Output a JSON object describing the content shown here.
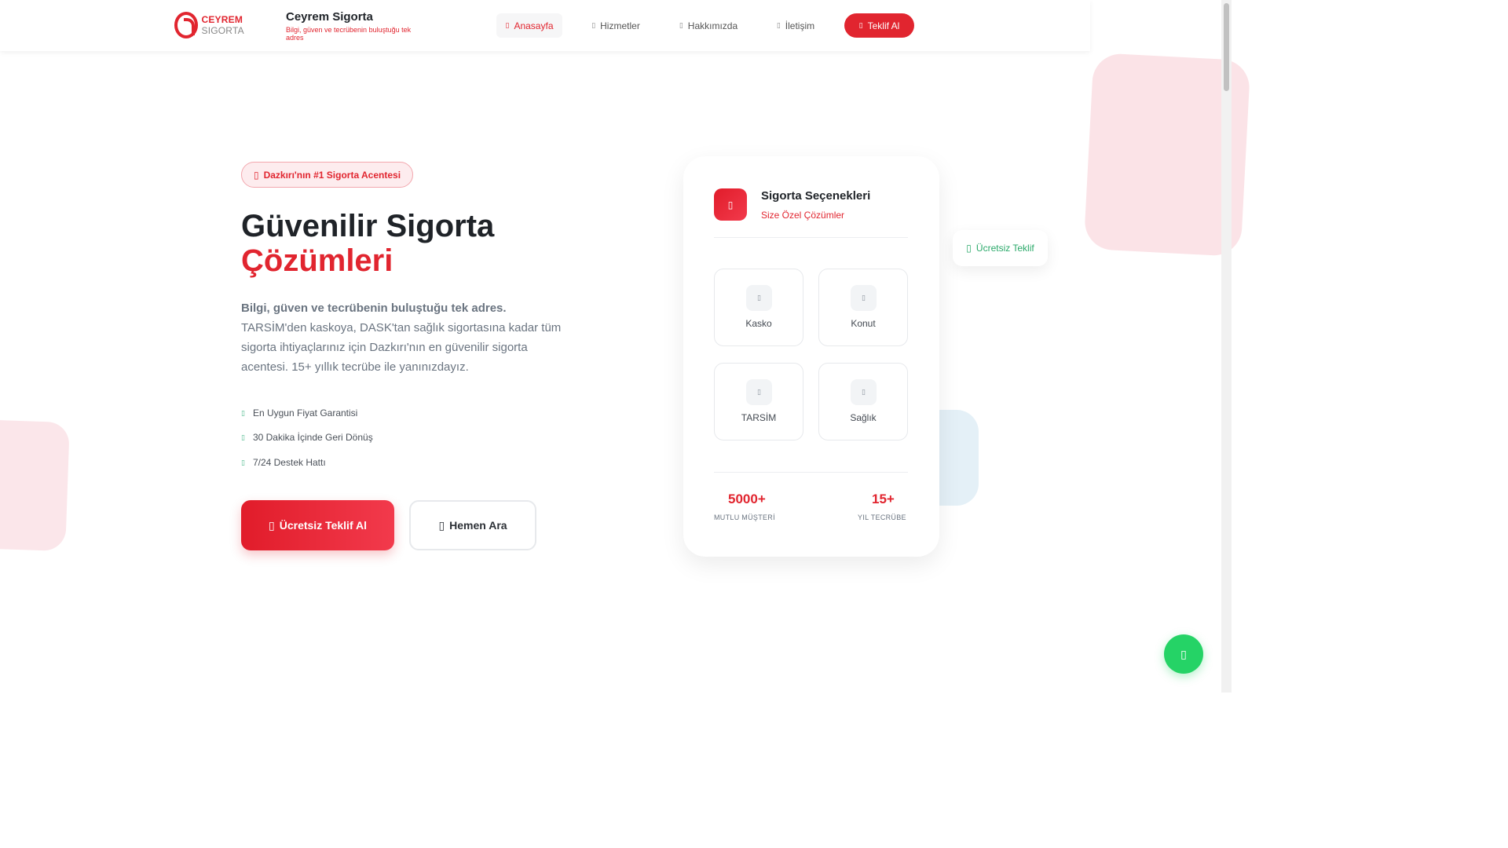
{
  "header": {
    "logo_text_a": "CEYREM",
    "logo_text_b": "SIGORTA",
    "brand_name": "Ceyrem Sigorta",
    "brand_tagline": "Bilgi, güven ve tecrübenin buluştuğu tek adres",
    "nav": {
      "home": "Anasayfa",
      "services": "Hizmetler",
      "about": "Hakkımızda",
      "contact": "İletişim",
      "quote": "Teklif Al"
    }
  },
  "hero": {
    "badge": "Dazkırı'nın #1 Sigorta Acentesi",
    "title_line1": "Güvenilir Sigorta",
    "title_line2": "Çözümleri",
    "lead_strong": "Bilgi, güven ve tecrübenin buluştuğu tek adres.",
    "lead_text": "TARSİM'den kaskoya, DASK'tan sağlık sigortasına kadar tüm sigorta ihtiyaçlarınız için Dazkırı'nın en güvenilir sigorta acentesi. 15+ yıllık tecrübe ile yanınızdayız.",
    "features": [
      "En Uygun Fiyat Garantisi",
      "30 Dakika İçinde Geri Dönüş",
      "7/24 Destek Hattı"
    ],
    "primary_button": "Ücretsiz Teklif Al",
    "secondary_button": "Hemen Ara"
  },
  "card": {
    "title": "Sigorta Seçenekleri",
    "subtitle": "Size Özel Çözümler",
    "tiles": [
      "Kasko",
      "Konut",
      "TARSİM",
      "Sağlık"
    ],
    "stats": [
      {
        "value": "5000+",
        "label": "MUTLU MÜŞTERİ"
      },
      {
        "value": "15+",
        "label": "YIL TECRÜBE"
      }
    ]
  },
  "float_chip": "Ücretsiz Teklif",
  "icons": {
    "nav_icon": "bullet-icon",
    "whatsapp": "whatsapp-icon"
  },
  "colors": {
    "brand_red": "#e1252f",
    "accent_green": "#25d366"
  }
}
